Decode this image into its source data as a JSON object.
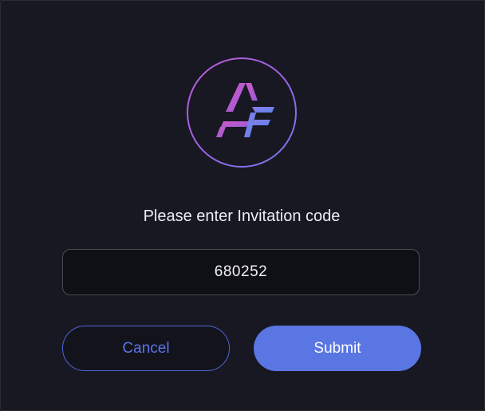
{
  "dialog": {
    "logo": {
      "icon": "af-logo-icon",
      "text": "AF"
    },
    "prompt": "Please enter Invitation code",
    "code_input": {
      "value": "680252",
      "placeholder": ""
    },
    "cancel_label": "Cancel",
    "submit_label": "Submit"
  },
  "colors": {
    "background": "#181823",
    "accent": "#5a76e3",
    "logo_gradient_start": "#c25bd8",
    "logo_gradient_end": "#6a7ef0"
  }
}
